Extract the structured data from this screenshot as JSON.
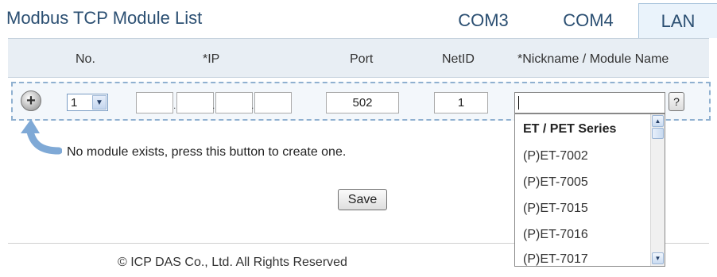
{
  "header": {
    "title": "Modbus TCP Module List",
    "tabs": [
      {
        "label": "COM3",
        "active": false
      },
      {
        "label": "COM4",
        "active": false
      },
      {
        "label": "LAN",
        "active": true
      }
    ]
  },
  "columns": [
    "No.",
    "*IP",
    "Port",
    "NetID",
    "*Nickname / Module Name"
  ],
  "row": {
    "no_value": "1",
    "ip_parts": [
      "",
      "",
      "",
      ""
    ],
    "ip_separator": ".",
    "port": "502",
    "netid": "1",
    "nickname": "",
    "help_label": "?"
  },
  "hint": "No module exists, press this button to create one.",
  "add_button": "+",
  "save_label": "Save",
  "footer": "© ICP DAS Co., Ltd. All Rights Reserved",
  "dropdown": {
    "group": "ET / PET Series",
    "items": [
      "(P)ET-7002",
      "(P)ET-7005",
      "(P)ET-7015",
      "(P)ET-7016",
      "(P)ET-7017"
    ]
  },
  "icons": {
    "add": "plus-circle-icon",
    "arrow": "curved-arrow-icon",
    "select_arrow": "chevron-down-icon",
    "scroll_up": "scroll-up-icon",
    "scroll_down": "scroll-down-icon"
  },
  "colors": {
    "title": "#2b4f72",
    "header_bar": "#e8eef4",
    "row_border": "#8fb0d0",
    "arrow": "#7fa9d6"
  }
}
